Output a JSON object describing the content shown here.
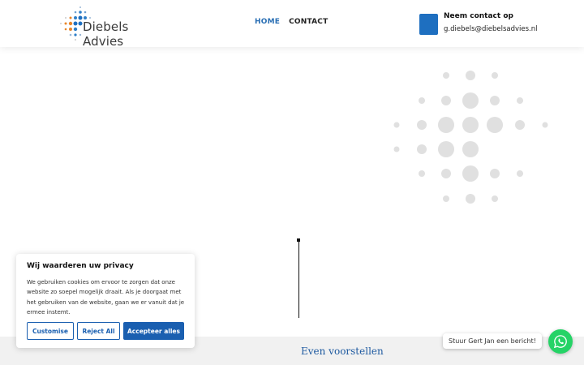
{
  "header": {
    "logo_text": "Diebels Advies",
    "nav": [
      {
        "label": "HOME",
        "active": true
      },
      {
        "label": "CONTACT",
        "active": false
      }
    ],
    "contact_title": "Neem contact op",
    "contact_email": "g.diebels@diebelsadvies.nl"
  },
  "main": {
    "section_title": "Even voorstellen"
  },
  "cookie": {
    "title": "Wij waarderen uw privacy",
    "text": "We gebruiken cookies om ervoor te zorgen dat onze website zo soepel mogelijk draait. Als je doorgaat met het gebruiken van de website, gaan we er vanuit dat je ermee instemt.",
    "customise_label": "Customise",
    "reject_label": "Reject All",
    "accept_label": "Accepteer alles"
  },
  "chat": {
    "bubble_text": "Stuur Gert Jan een bericht!"
  },
  "colors": {
    "brand_blue": "#1e6fc0",
    "accent_orange": "#e8862a",
    "whatsapp_green": "#25d366"
  },
  "icons": {
    "contact": "contact-square-icon",
    "chat": "whatsapp-icon"
  }
}
